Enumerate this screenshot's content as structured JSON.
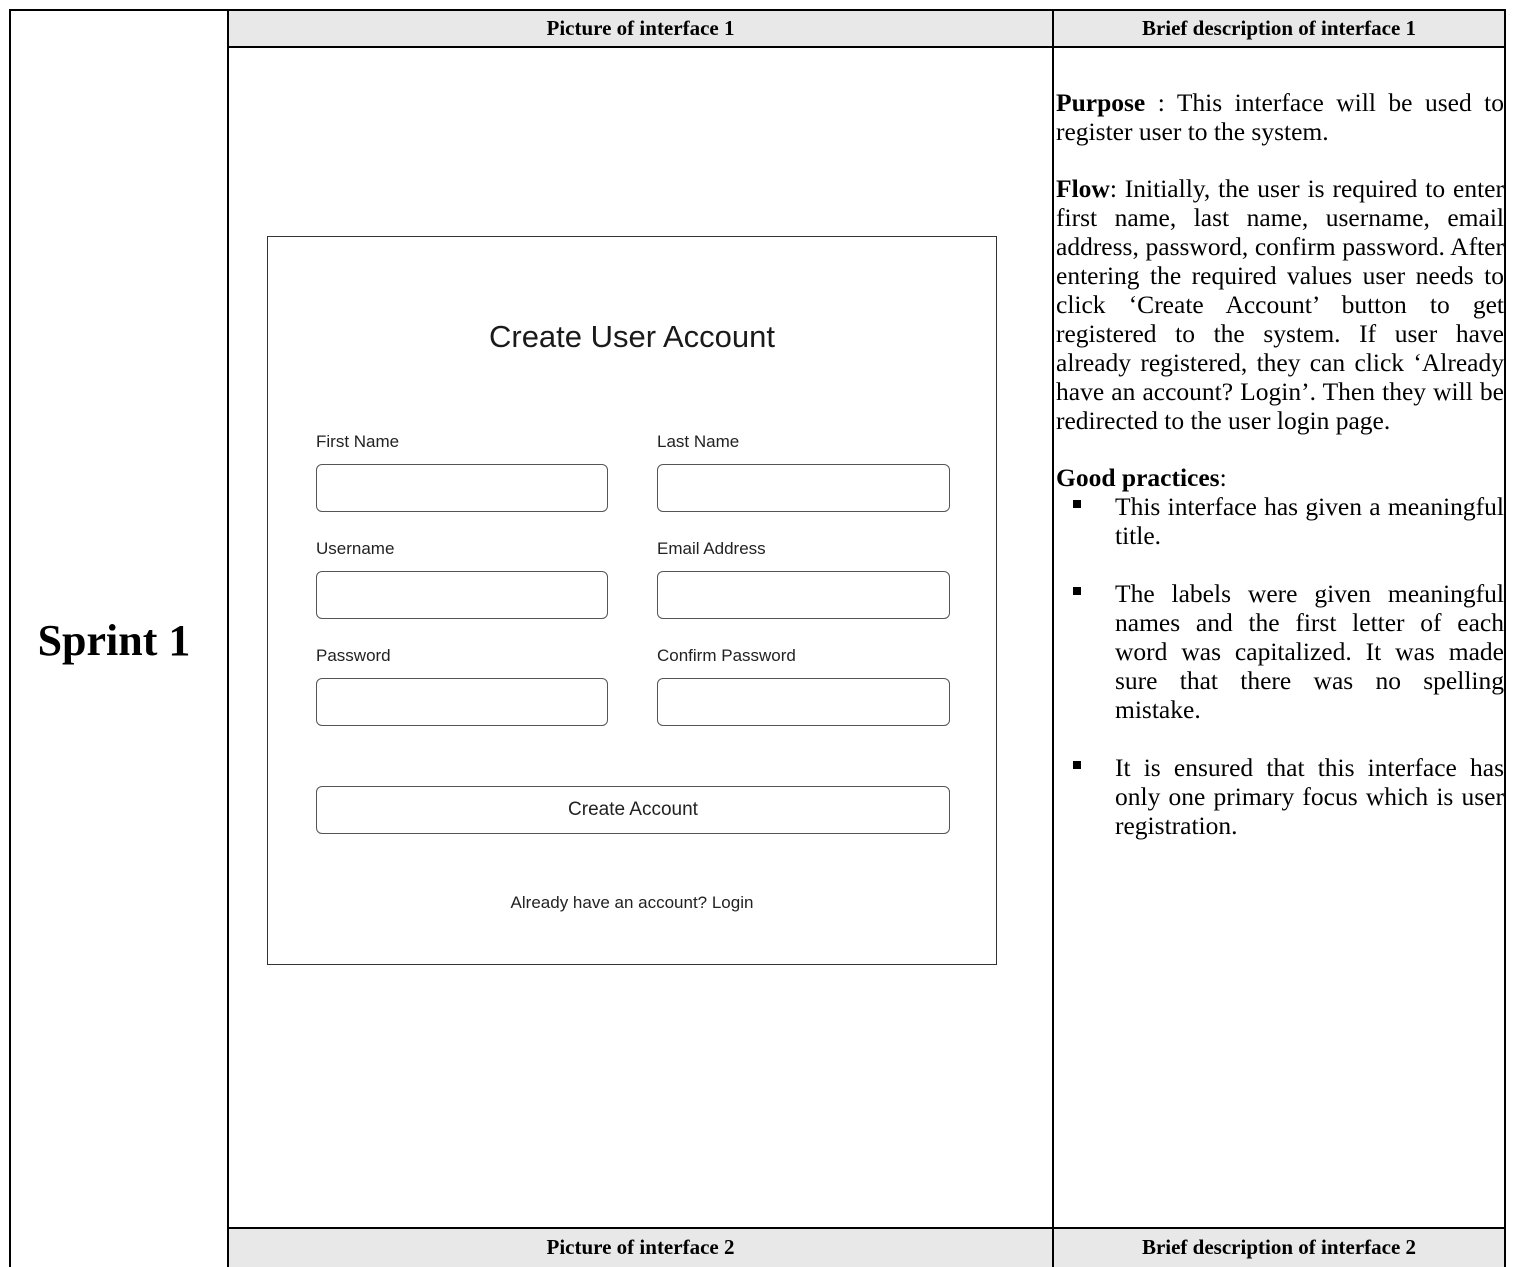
{
  "table": {
    "row_label": "Sprint 1",
    "header_1_left": "Picture of interface 1",
    "header_1_right": "Brief description of interface 1",
    "header_2_left": "Picture of interface 2",
    "header_2_right": "Brief description of interface 2"
  },
  "mockup": {
    "title": "Create User Account",
    "fields": {
      "first_name": {
        "label": "First Name",
        "value": ""
      },
      "last_name": {
        "label": "Last Name",
        "value": ""
      },
      "username": {
        "label": "Username",
        "value": ""
      },
      "email": {
        "label": "Email Address",
        "value": ""
      },
      "password": {
        "label": "Password",
        "value": ""
      },
      "confirm_password": {
        "label": "Confirm Password",
        "value": ""
      }
    },
    "create_button": "Create Account",
    "login_link": "Already have an account? Login"
  },
  "description": {
    "purpose_label": "Purpose",
    "purpose_text": " : This interface will be used to register user to the system.",
    "flow_label": "Flow",
    "flow_text": ": Initially, the user is required to enter first name, last name, username, email address, password, confirm password. After entering the required values user needs to click ‘Create Account’ button to get registered to the system. If user have already registered, they can click ‘Already have an account? Login’. Then they will be redirected to the user login page.",
    "good_practices_label": "Good practices",
    "good_practices_colon": ":",
    "practices": [
      "This interface has given a meaningful title.",
      "The labels were given meaningful names and the first letter of each word was capitalized. It was made sure that there was no spelling mistake.",
      "It is ensured that this interface has only one primary focus which is user registration."
    ]
  }
}
